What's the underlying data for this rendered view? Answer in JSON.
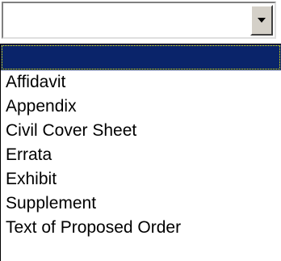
{
  "select": {
    "value": "",
    "button_icon": "chevron-down-icon"
  },
  "options": [
    {
      "label": "",
      "selected": true
    },
    {
      "label": "Affidavit",
      "selected": false
    },
    {
      "label": "Appendix",
      "selected": false
    },
    {
      "label": "Civil Cover Sheet",
      "selected": false
    },
    {
      "label": "Errata",
      "selected": false
    },
    {
      "label": "Exhibit",
      "selected": false
    },
    {
      "label": "Supplement",
      "selected": false
    },
    {
      "label": "Text of Proposed Order",
      "selected": false
    }
  ],
  "colors": {
    "selection_bg": "#0a246a",
    "button_face": "#d4d0c8"
  }
}
